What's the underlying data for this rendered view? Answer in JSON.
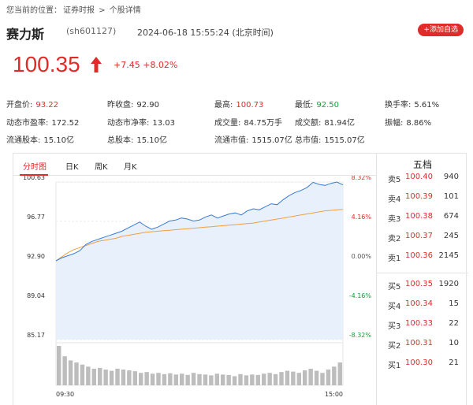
{
  "breadcrumb": {
    "prefix": "您当前的位置：",
    "items": [
      "证券时报",
      "个股详情"
    ],
    "sep": ">"
  },
  "stock": {
    "name": "赛力斯",
    "code": "(sh601127)",
    "time": "2024-06-18 15:55:24 (北京时间)",
    "add_label": "+添加自选",
    "price": "100.35",
    "change": "+7.45 +8.02%"
  },
  "quotes": [
    [
      {
        "label": "开盘价:",
        "value": "93.22",
        "color": "red"
      },
      {
        "label": "昨收盘:",
        "value": "92.90",
        "color": ""
      },
      {
        "label": "最高:",
        "value": "100.73",
        "color": "red"
      },
      {
        "label": "最低:",
        "value": "92.50",
        "color": "green"
      },
      {
        "label": "换手率:",
        "value": "5.61%",
        "color": ""
      }
    ],
    [
      {
        "label": "动态市盈率:",
        "value": "172.52",
        "color": ""
      },
      {
        "label": "动态市净率:",
        "value": "13.03",
        "color": ""
      },
      {
        "label": "成交量:",
        "value": "84.75万手",
        "color": ""
      },
      {
        "label": "成交额:",
        "value": "81.94亿",
        "color": ""
      },
      {
        "label": "振幅:",
        "value": "8.86%",
        "color": ""
      }
    ],
    [
      {
        "label": "流通股本:",
        "value": "15.10亿",
        "color": ""
      },
      {
        "label": "总股本:",
        "value": "15.10亿",
        "color": ""
      },
      {
        "label": "流通市值:",
        "value": "1515.07亿",
        "color": ""
      },
      {
        "label": "总市值:",
        "value": "1515.07亿",
        "color": ""
      }
    ]
  ],
  "tabs": [
    "分时图",
    "日K",
    "周K",
    "月K"
  ],
  "order_book": {
    "title": "五档",
    "sell": [
      {
        "label": "卖5",
        "price": "100.40",
        "vol": "940"
      },
      {
        "label": "卖4",
        "price": "100.39",
        "vol": "101"
      },
      {
        "label": "卖3",
        "price": "100.38",
        "vol": "674"
      },
      {
        "label": "卖2",
        "price": "100.37",
        "vol": "245"
      },
      {
        "label": "卖1",
        "price": "100.36",
        "vol": "2145"
      }
    ],
    "buy": [
      {
        "label": "买5",
        "price": "100.35",
        "vol": "1920"
      },
      {
        "label": "买4",
        "price": "100.34",
        "vol": "15"
      },
      {
        "label": "买3",
        "price": "100.33",
        "vol": "22"
      },
      {
        "label": "买2",
        "price": "100.31",
        "vol": "10"
      },
      {
        "label": "买1",
        "price": "100.30",
        "vol": "21"
      }
    ]
  },
  "chart_data": {
    "type": "line",
    "y_ticks": [
      "100.63",
      "96.77",
      "92.90",
      "89.04",
      "85.17"
    ],
    "y_values": [
      100.63,
      96.77,
      92.9,
      89.04,
      85.17
    ],
    "pct_ticks": [
      "8.32%",
      "4.16%",
      "0.00%",
      "-4.16%",
      "-8.32%"
    ],
    "x_ticks": [
      "09:30",
      "15:00"
    ],
    "ylim": [
      85.17,
      100.63
    ],
    "prev_close": 92.9,
    "series": [
      {
        "values": [
          92.9,
          93.2,
          93.4,
          93.6,
          93.9,
          94.5,
          94.8,
          95.0,
          95.2,
          95.4,
          95.6,
          95.8,
          96.1,
          96.4,
          96.7,
          96.3,
          96.0,
          96.2,
          96.5,
          96.8,
          96.9,
          97.1,
          97.0,
          96.8,
          96.9,
          97.2,
          97.4,
          97.1,
          97.3,
          97.5,
          97.6,
          97.4,
          97.8,
          98.0,
          97.9,
          98.2,
          98.5,
          98.4,
          98.9,
          99.3,
          99.6,
          99.8,
          100.1,
          100.6,
          100.4,
          100.3,
          100.5,
          100.63,
          100.35
        ]
      },
      {
        "values": [
          92.9,
          93.3,
          93.7,
          94.0,
          94.2,
          94.4,
          94.6,
          94.8,
          94.9,
          95.0,
          95.1,
          95.3,
          95.4,
          95.5,
          95.6,
          95.7,
          95.75,
          95.8,
          95.85,
          95.9,
          95.95,
          96.0,
          96.05,
          96.1,
          96.15,
          96.2,
          96.25,
          96.3,
          96.35,
          96.4,
          96.45,
          96.5,
          96.55,
          96.6,
          96.7,
          96.8,
          96.9,
          97.0,
          97.1,
          97.2,
          97.3,
          97.4,
          97.5,
          97.6,
          97.7,
          97.8,
          97.85,
          97.9,
          97.95
        ]
      }
    ],
    "volume": [
      95,
      70,
      60,
      55,
      50,
      45,
      40,
      42,
      38,
      35,
      40,
      38,
      36,
      34,
      30,
      32,
      28,
      30,
      27,
      29,
      26,
      28,
      25,
      30,
      27,
      26,
      24,
      28,
      26,
      25,
      22,
      27,
      24,
      26,
      25,
      28,
      30,
      27,
      32,
      35,
      33,
      30,
      36,
      40,
      35,
      30,
      38,
      45,
      55
    ],
    "colors": {
      "price": "#3a7bd5",
      "avg": "#f0a040",
      "up": "#e02b2b",
      "down": "#1a9a3a",
      "fill": "#e8f0fb"
    }
  }
}
